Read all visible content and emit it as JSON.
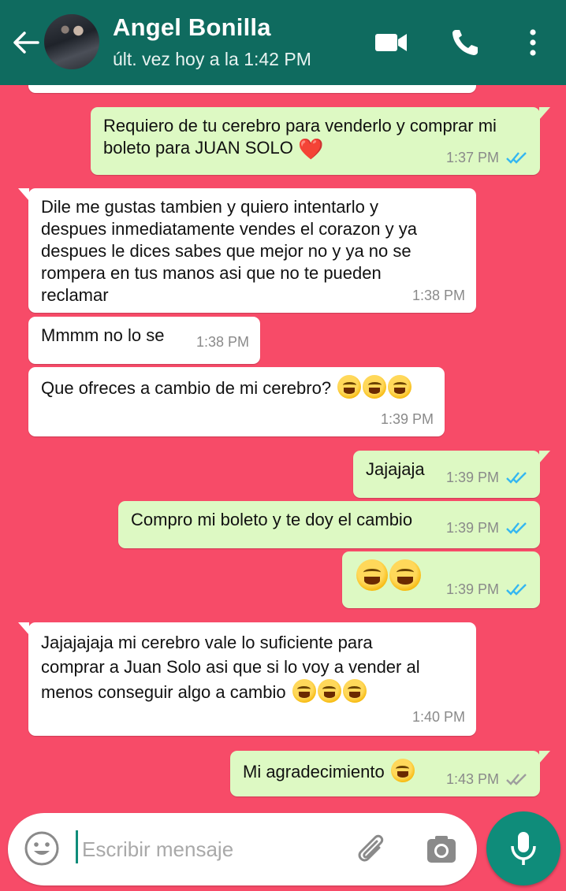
{
  "header": {
    "contact_name": "Angel Bonilla",
    "status": "últ. vez hoy a la 1:42 PM",
    "icons": [
      "back-arrow-icon",
      "video-call-icon",
      "phone-icon",
      "more-options-icon"
    ],
    "color": "#0f6b5f"
  },
  "colors": {
    "chat_background": "#f74b68",
    "incoming": "#ffffff",
    "outgoing": "#ddf9c3",
    "read_ticks": "#34b7f1",
    "sent_ticks": "#9e9e9e"
  },
  "messages": [
    {
      "dir": "out",
      "text": "Requiero de tu cerebro para venderlo y comprar mi boleto para JUAN SOLO",
      "emoji": "❤️",
      "time": "1:37 PM",
      "status": "read"
    },
    {
      "dir": "in",
      "text": "Dile me gustas tambien y quiero intentarlo y despues inmediatamente vendes el corazon y ya despues le dices sabes que mejor no y ya no se rompera en tus manos asi que no te pueden reclamar",
      "time": "1:38 PM"
    },
    {
      "dir": "in",
      "text": "Mmmm no lo se",
      "time": "1:38 PM"
    },
    {
      "dir": "in",
      "text": "Que ofreces a cambio de mi cerebro?",
      "emoji": "😂😂😂",
      "time": "1:39 PM"
    },
    {
      "dir": "out",
      "text": "Jajajaja",
      "time": "1:39 PM",
      "status": "read"
    },
    {
      "dir": "out",
      "text": "Compro mi boleto y te doy el cambio",
      "time": "1:39 PM",
      "status": "read"
    },
    {
      "dir": "out",
      "text": "",
      "emoji": "😂😂",
      "time": "1:39 PM",
      "status": "read"
    },
    {
      "dir": "in",
      "text": "Jajajajaja mi cerebro vale lo suficiente para comprar a Juan Solo asi que si lo voy a vender al menos conseguir algo a cambio",
      "emoji": "😂😂😂",
      "time": "1:40 PM"
    },
    {
      "dir": "out",
      "text": "Mi agradecimiento",
      "emoji": "😂",
      "time": "1:43 PM",
      "status": "delivered"
    }
  ],
  "composer": {
    "placeholder": "Escribir mensaje",
    "icons": [
      "emoji-icon",
      "attach-icon",
      "camera-icon",
      "microphone-icon"
    ]
  }
}
